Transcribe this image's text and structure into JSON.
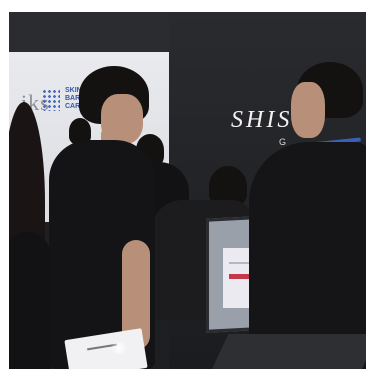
{
  "photo": {
    "brand_left": "iks",
    "skin_lines": [
      "SKIN",
      "BARE",
      "CARE"
    ],
    "brand_right": "SHIS",
    "brand_right_sub": "G"
  }
}
